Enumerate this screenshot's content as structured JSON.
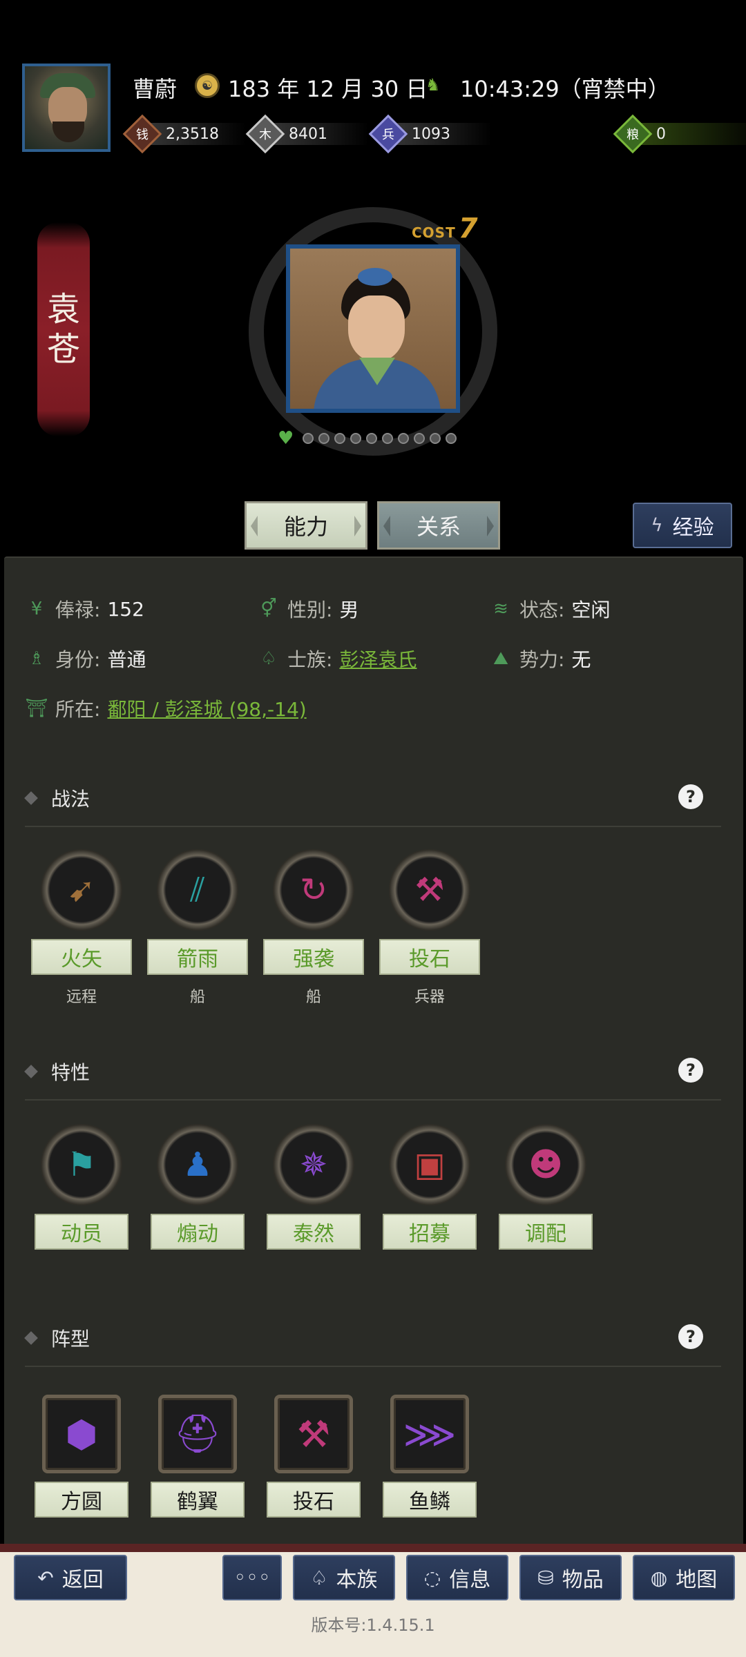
{
  "header": {
    "player_name": "曹蔚",
    "date": "183 年 12 月 30 日",
    "time": "10:43:29（宵禁中）",
    "resources": {
      "gold": "2,3518",
      "wood": "8401",
      "soldiers": "1093",
      "food": "0"
    }
  },
  "hero": {
    "name_chars": [
      "袁",
      "苍"
    ],
    "cost_label": "COST",
    "cost_value": "7",
    "loyalty_dots_total": 10
  },
  "tabs": {
    "ability": "能力",
    "relation": "关系",
    "experience": "经验"
  },
  "info": {
    "salary_label": "俸禄:",
    "salary_value": "152",
    "gender_label": "性别:",
    "gender_value": "男",
    "status_label": "状态:",
    "status_value": "空闲",
    "identity_label": "身份:",
    "identity_value": "普通",
    "clan_label": "士族:",
    "clan_value": "彭泽袁氏",
    "faction_label": "势力:",
    "faction_value": "无",
    "location_label": "所在:",
    "location_value": "鄱阳 / 彭泽城 (98,-14)"
  },
  "sections": {
    "tactics": {
      "title": "战法",
      "items": [
        {
          "name": "火矢",
          "type": "远程",
          "icon": "fire-arrow-icon"
        },
        {
          "name": "箭雨",
          "type": "船",
          "icon": "arrow-rain-icon"
        },
        {
          "name": "强袭",
          "type": "船",
          "icon": "assault-icon"
        },
        {
          "name": "投石",
          "type": "兵器",
          "icon": "catapult-icon"
        }
      ]
    },
    "traits": {
      "title": "特性",
      "items": [
        {
          "name": "动员",
          "icon": "mobilize-flag-icon"
        },
        {
          "name": "煽动",
          "icon": "incite-icon"
        },
        {
          "name": "泰然",
          "icon": "calm-icon"
        },
        {
          "name": "招募",
          "icon": "recruit-icon"
        },
        {
          "name": "调配",
          "icon": "allocate-icon"
        }
      ]
    },
    "formations": {
      "title": "阵型",
      "items": [
        {
          "name": "方圆",
          "icon": "turtle-shell-icon"
        },
        {
          "name": "鹤翼",
          "icon": "helmet-icon"
        },
        {
          "name": "投石",
          "icon": "catapult-icon"
        },
        {
          "name": "鱼鳞",
          "icon": "claw-icon"
        }
      ]
    }
  },
  "bottom_nav": {
    "back": "返回",
    "more": "◦◦◦",
    "clan": "本族",
    "info": "信息",
    "items": "物品",
    "map": "地图"
  },
  "version": "版本号:1.4.15.1"
}
